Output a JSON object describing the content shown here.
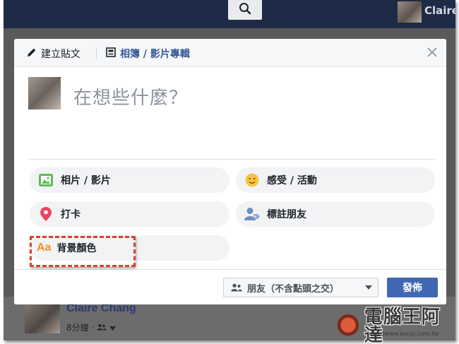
{
  "header": {
    "user_name": "Claire"
  },
  "composer": {
    "tabs": [
      {
        "label": "建立貼文",
        "icon": "pencil-icon"
      },
      {
        "label": "相簿 / 影片專輯",
        "icon": "album-icon"
      }
    ],
    "placeholder": "在想些什麼？",
    "actions": [
      {
        "label": "相片 / 影片",
        "icon": "photo-icon"
      },
      {
        "label": "感受 / 活動",
        "icon": "smiley-icon"
      },
      {
        "label": "打卡",
        "icon": "location-pin-icon"
      },
      {
        "label": "標註朋友",
        "icon": "tag-friends-icon"
      },
      {
        "label": "背景顏色",
        "icon": "background-color-icon",
        "icon_text": "Aa"
      }
    ],
    "audience_label": "朋友（不含點頭之交）",
    "post_label": "發佈"
  },
  "background_post": {
    "author": "Claire Chang",
    "time": "8分鐘 ·"
  },
  "watermark": {
    "text": "電腦王阿達",
    "url": "http://www.kocpc.com.tw"
  },
  "colors": {
    "brand_blue": "#4267b2",
    "link_blue": "#385898",
    "highlight_red": "#d9412f",
    "aa_orange": "#f5901d",
    "nav_bar": "#1e2a46"
  }
}
